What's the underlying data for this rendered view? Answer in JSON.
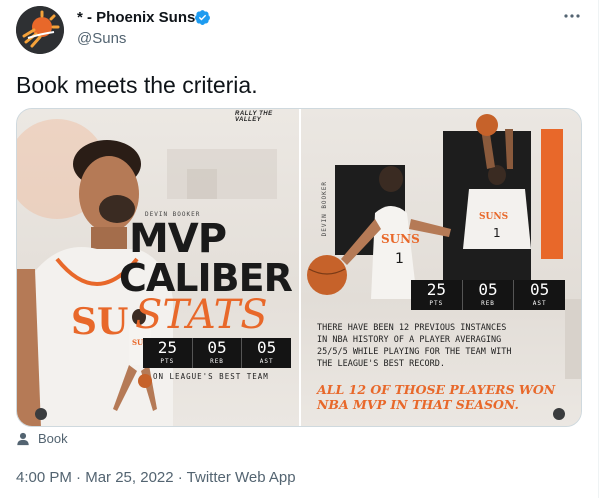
{
  "author": {
    "display_name": "* - Phoenix Suns",
    "handle": "@Suns",
    "avatar_icon": "suns-logo-icon",
    "verified_icon": "verified-badge-icon"
  },
  "menu_icon": "more-options-icon",
  "tweet_text": "Book meets the criteria.",
  "media": {
    "left": {
      "brand": "RALLY THE VALLEY",
      "player_name": "DEVIN BOOKER",
      "title_line1": "MVP",
      "title_line2": "CALIBER",
      "title_line3": "STATS",
      "stats": [
        {
          "value": "25",
          "label": "PTS"
        },
        {
          "value": "05",
          "label": "REB"
        },
        {
          "value": "05",
          "label": "AST"
        }
      ],
      "footer": "ON LEAGUE'S BEST TEAM"
    },
    "right": {
      "player_name": "DEVIN BOOKER",
      "stats": [
        {
          "value": "25",
          "label": "PTS"
        },
        {
          "value": "05",
          "label": "REB"
        },
        {
          "value": "05",
          "label": "AST"
        }
      ],
      "caption": "THERE HAVE BEEN 12 PREVIOUS INSTANCES\nIN NBA HISTORY OF A PLAYER AVERAGING\n25/5/5 WHILE PLAYING FOR THE TEAM WITH\nTHE LEAGUE'S BEST RECORD.",
      "highlight": "ALL 12 OF THOSE PLAYERS WON\nNBA MVP IN THAT SEASON."
    },
    "accent_color": "#e8682a"
  },
  "tagged": {
    "icon": "person-icon",
    "name": "Book"
  },
  "meta": {
    "time": "4:00 PM",
    "separator": " · ",
    "date": "Mar 25, 2022",
    "source": "Twitter Web App"
  }
}
